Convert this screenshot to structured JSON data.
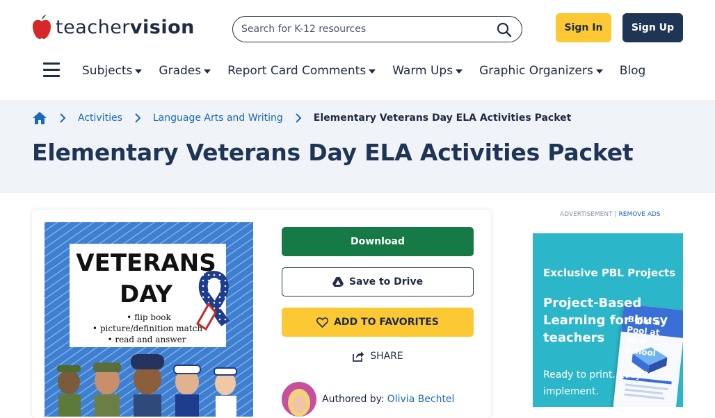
{
  "brand": {
    "name_light": "teacher",
    "name_bold": "vision",
    "colors": {
      "navy": "#1f3556",
      "yellow": "#fcc934",
      "green": "#157a45",
      "link": "#1a6ab8",
      "band": "#f0f3f8",
      "ad": "#2cb6c9"
    }
  },
  "header": {
    "search_placeholder": "Search for K-12 resources",
    "search_icon": "search-icon",
    "sign_in": "Sign In",
    "sign_up": "Sign Up"
  },
  "nav": {
    "menu_icon": "hamburger-icon",
    "items": [
      {
        "label": "Subjects",
        "dropdown": true
      },
      {
        "label": "Grades",
        "dropdown": true
      },
      {
        "label": "Report Card Comments",
        "dropdown": true
      },
      {
        "label": "Warm Ups",
        "dropdown": true
      },
      {
        "label": "Graphic Organizers",
        "dropdown": true
      },
      {
        "label": "Blog",
        "dropdown": false
      }
    ]
  },
  "breadcrumb": {
    "home_icon": "home-icon",
    "items": [
      "Activities",
      "Language Arts and Writing"
    ],
    "current": "Elementary Veterans Day ELA Activities Packet"
  },
  "page": {
    "title": "Elementary Veterans Day ELA Activities Packet"
  },
  "resource": {
    "thumbnail": {
      "title_line1": "VETERANS",
      "title_line2": "DAY",
      "bullets": [
        "• flip book",
        "• picture/definition match",
        "• read and answer"
      ]
    },
    "download": "Download",
    "save_to_drive": "Save to Drive",
    "add_to_favorites": "ADD TO FAVORITES",
    "share": "SHARE",
    "author_label": "Authored by:",
    "author_name": "Olivia Bechtel"
  },
  "ad": {
    "label": "ADVERTISEMENT |",
    "remove": "REMOVE ADS",
    "headline": "Exclusive PBL Projects",
    "subhead": "Project-Based Learning for busy teachers",
    "copy": "Ready to print. Easy to implement.",
    "book_title": "Build a Pool at Your School"
  }
}
